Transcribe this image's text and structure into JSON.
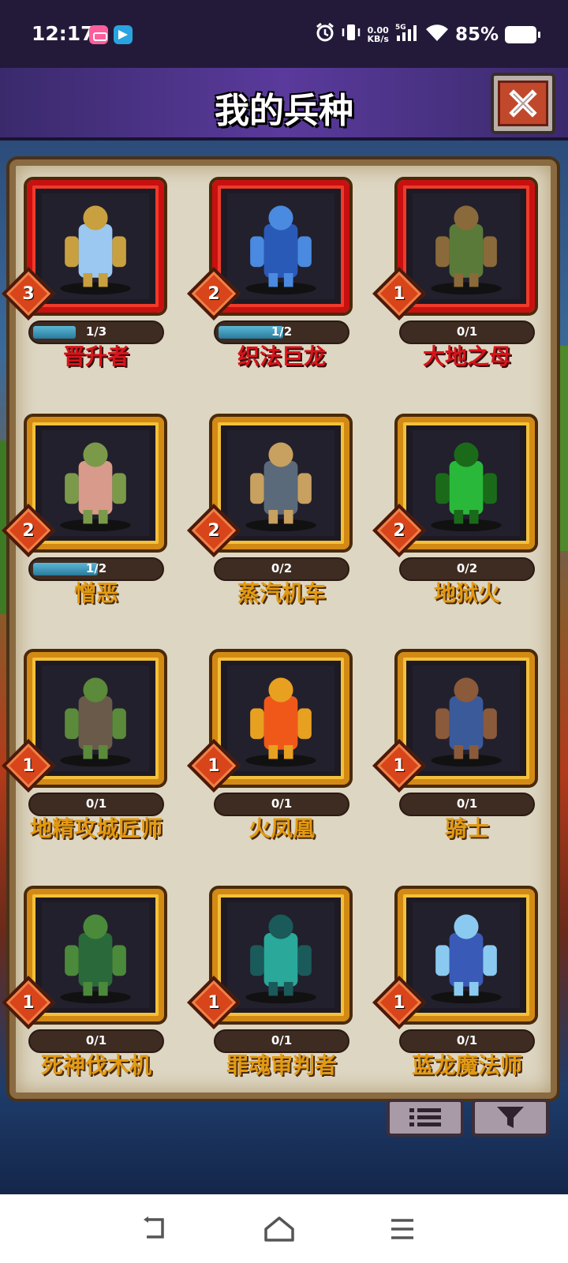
{
  "status_bar": {
    "time": "12:17",
    "net_speed_value": "0.00",
    "net_speed_unit": "KB/s",
    "network_type": "5G",
    "battery": "85%",
    "battery_level": 0.85
  },
  "header": {
    "title": "我的兵种"
  },
  "units": [
    {
      "name": "晋升者",
      "level": "3",
      "progress": "1/3",
      "progress_fraction": 0.33,
      "rarity": "red",
      "portrait": "angel-warrior"
    },
    {
      "name": "织法巨龙",
      "level": "2",
      "progress": "1/2",
      "progress_fraction": 0.5,
      "rarity": "red",
      "portrait": "blue-dragon"
    },
    {
      "name": "大地之母",
      "level": "1",
      "progress": "0/1",
      "progress_fraction": 0,
      "rarity": "red",
      "portrait": "earth-treant"
    },
    {
      "name": "憎恶",
      "level": "2",
      "progress": "1/2",
      "progress_fraction": 0.5,
      "rarity": "gold",
      "portrait": "abomination"
    },
    {
      "name": "蒸汽机车",
      "level": "2",
      "progress": "0/2",
      "progress_fraction": 0,
      "rarity": "gold",
      "portrait": "steam-tank"
    },
    {
      "name": "地狱火",
      "level": "2",
      "progress": "0/2",
      "progress_fraction": 0,
      "rarity": "gold",
      "portrait": "green-infernal"
    },
    {
      "name": "地精攻城匠师",
      "level": "1",
      "progress": "0/1",
      "progress_fraction": 0,
      "rarity": "gold",
      "portrait": "goblin-siege"
    },
    {
      "name": "火凤凰",
      "level": "1",
      "progress": "0/1",
      "progress_fraction": 0,
      "rarity": "gold",
      "portrait": "phoenix"
    },
    {
      "name": "骑士",
      "level": "1",
      "progress": "0/1",
      "progress_fraction": 0,
      "rarity": "gold",
      "portrait": "knight"
    },
    {
      "name": "死神伐木机",
      "level": "1",
      "progress": "0/1",
      "progress_fraction": 0,
      "rarity": "gold",
      "portrait": "reaper-shredder"
    },
    {
      "name": "罪魂审判者",
      "level": "1",
      "progress": "0/1",
      "progress_fraction": 0,
      "rarity": "gold",
      "portrait": "ghost-judge"
    },
    {
      "name": "蓝龙魔法师",
      "level": "1",
      "progress": "0/1",
      "progress_fraction": 0,
      "rarity": "gold",
      "portrait": "dragon-mage"
    }
  ],
  "colors": {
    "title_bar": "#4a3a8c",
    "parchment": "#ddd6c2",
    "frame_gold": "#d38a14",
    "frame_red": "#c81010",
    "name_gold": "#e39a12",
    "name_red": "#d8141a",
    "progress_fill": "#3a9ac0"
  },
  "icons": {
    "close": "close-icon",
    "list": "list-icon",
    "filter": "filter-icon",
    "nav_back": "back-icon",
    "nav_home": "home-icon",
    "nav_menu": "menu-icon"
  }
}
